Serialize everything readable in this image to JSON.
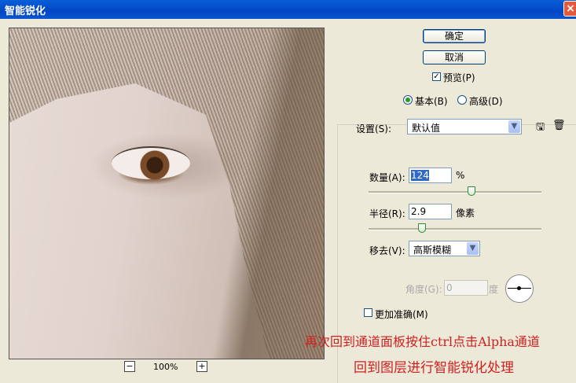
{
  "window": {
    "title": "智能锐化"
  },
  "preview": {
    "zoom": "100%",
    "zoom_out": "−",
    "zoom_in": "+"
  },
  "buttons": {
    "ok": "确定",
    "cancel": "取消"
  },
  "preview_toggle": {
    "label": "预览(P)",
    "checked": true
  },
  "mode": {
    "basic": "基本(B)",
    "advanced": "高级(D)",
    "selected": "basic"
  },
  "settings": {
    "label": "设置(S):",
    "value": "默认值"
  },
  "amount": {
    "label": "数量(A):",
    "value": "124",
    "unit": "%",
    "slider_fraction": 0.6
  },
  "radius": {
    "label": "半径(R):",
    "value": "2.9",
    "unit": "像素",
    "slider_fraction": 0.3
  },
  "remove": {
    "label": "移去(V):",
    "value": "高斯模糊"
  },
  "angle": {
    "label": "角度(G):",
    "value": "0",
    "unit": "度"
  },
  "more_accurate": {
    "label": "更加准确(M)",
    "checked": false
  },
  "captions": {
    "line1": "再次回到通道面板按住ctrl点击Alpha通道",
    "line2": "回到图层进行智能锐化处理"
  }
}
